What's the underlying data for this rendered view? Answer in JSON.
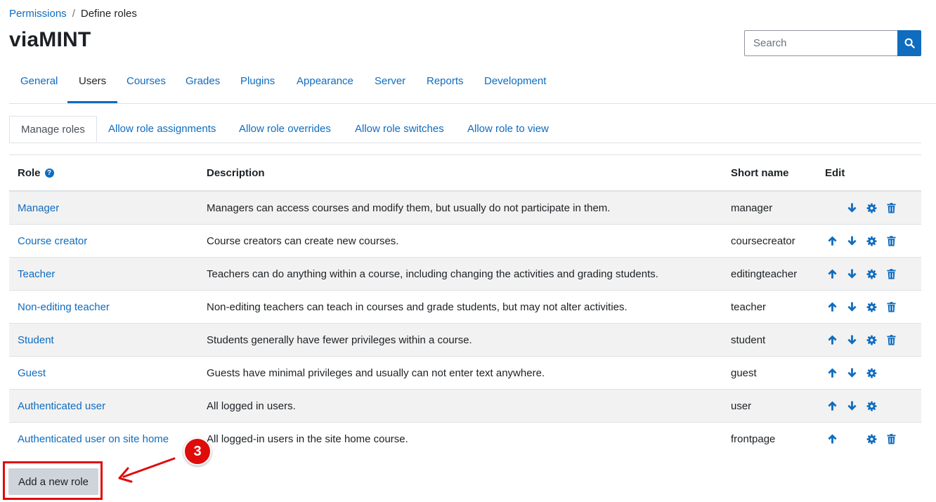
{
  "breadcrumb": {
    "parent": "Permissions",
    "separator": "/",
    "current": "Define roles"
  },
  "page": {
    "title": "viaMINT"
  },
  "search": {
    "placeholder": "Search",
    "icon": "search-icon"
  },
  "primary_tabs": [
    {
      "label": "General",
      "active": false
    },
    {
      "label": "Users",
      "active": true
    },
    {
      "label": "Courses",
      "active": false
    },
    {
      "label": "Grades",
      "active": false
    },
    {
      "label": "Plugins",
      "active": false
    },
    {
      "label": "Appearance",
      "active": false
    },
    {
      "label": "Server",
      "active": false
    },
    {
      "label": "Reports",
      "active": false
    },
    {
      "label": "Development",
      "active": false
    }
  ],
  "sub_tabs": [
    {
      "label": "Manage roles",
      "active": true
    },
    {
      "label": "Allow role assignments",
      "active": false
    },
    {
      "label": "Allow role overrides",
      "active": false
    },
    {
      "label": "Allow role switches",
      "active": false
    },
    {
      "label": "Allow role to view",
      "active": false
    }
  ],
  "table": {
    "headers": {
      "role": "Role",
      "description": "Description",
      "short_name": "Short name",
      "edit": "Edit"
    },
    "rows": [
      {
        "role": "Manager",
        "description": "Managers can access courses and modify them, but usually do not participate in them.",
        "short_name": "manager",
        "up": false,
        "down": true,
        "settings": true,
        "delete": true
      },
      {
        "role": "Course creator",
        "description": "Course creators can create new courses.",
        "short_name": "coursecreator",
        "up": true,
        "down": true,
        "settings": true,
        "delete": true
      },
      {
        "role": "Teacher",
        "description": "Teachers can do anything within a course, including changing the activities and grading students.",
        "short_name": "editingteacher",
        "up": true,
        "down": true,
        "settings": true,
        "delete": true
      },
      {
        "role": "Non-editing teacher",
        "description": "Non-editing teachers can teach in courses and grade students, but may not alter activities.",
        "short_name": "teacher",
        "up": true,
        "down": true,
        "settings": true,
        "delete": true
      },
      {
        "role": "Student",
        "description": "Students generally have fewer privileges within a course.",
        "short_name": "student",
        "up": true,
        "down": true,
        "settings": true,
        "delete": true
      },
      {
        "role": "Guest",
        "description": "Guests have minimal privileges and usually can not enter text anywhere.",
        "short_name": "guest",
        "up": true,
        "down": true,
        "settings": true,
        "delete": false
      },
      {
        "role": "Authenticated user",
        "description": "All logged in users.",
        "short_name": "user",
        "up": true,
        "down": true,
        "settings": true,
        "delete": false
      },
      {
        "role": "Authenticated user on site home",
        "description": "All logged-in users in the site home course.",
        "short_name": "frontpage",
        "up": true,
        "down": false,
        "settings": true,
        "delete": true
      }
    ]
  },
  "actions": {
    "add_role_label": "Add a new role"
  },
  "annotation": {
    "step_number": "3",
    "color": "#e00b0b"
  },
  "colors": {
    "accent": "#0f6cbf",
    "stripe": "#f2f2f2"
  }
}
